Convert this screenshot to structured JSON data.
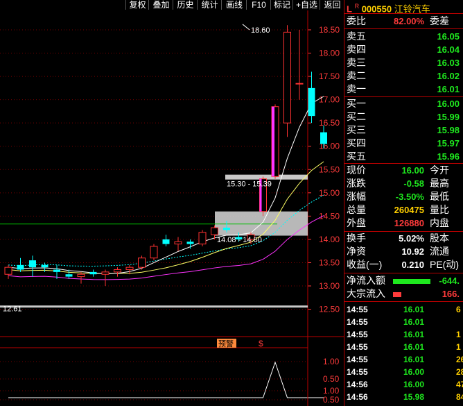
{
  "toolbar": {
    "buttons": [
      "复权",
      "叠加",
      "历史",
      "统计",
      "画线",
      "F10",
      "标记",
      "+自选",
      "返回"
    ]
  },
  "chart": {
    "price_ticks": [
      "18.50",
      "18.00",
      "17.50",
      "17.00",
      "16.50",
      "16.00",
      "15.50",
      "15.00",
      "14.50",
      "14.00",
      "13.50",
      "13.00",
      "12.50"
    ],
    "sub_ticks": [
      "1.00",
      "0.50",
      "1.00",
      "0.50"
    ],
    "high_label": "18.60",
    "low_label": "12.61",
    "zone_upper_label": "15.30 - 15.39",
    "zone_lower_label": "14.08 - 14.60",
    "signal_label": "预警",
    "dollar_label": "$",
    "colors": {
      "up": "#ff3232",
      "down": "#00ffff",
      "ma5": "#ffffff",
      "ma10": "#ffff66",
      "ma20": "#ff33ff",
      "ma60": "#00ffff",
      "hline": "#00c000"
    }
  },
  "chart_data": {
    "type": "candlestick",
    "ylim": [
      12.5,
      18.8
    ],
    "candles": [
      {
        "o": 13.25,
        "h": 13.45,
        "l": 13.15,
        "c": 13.4
      },
      {
        "o": 13.45,
        "h": 13.6,
        "l": 13.3,
        "c": 13.35
      },
      {
        "o": 13.55,
        "h": 13.65,
        "l": 13.2,
        "c": 13.4
      },
      {
        "o": 13.45,
        "h": 13.5,
        "l": 13.3,
        "c": 13.4
      },
      {
        "o": 13.35,
        "h": 13.45,
        "l": 13.15,
        "c": 13.3
      },
      {
        "o": 13.25,
        "h": 13.35,
        "l": 13.15,
        "c": 13.2
      },
      {
        "o": 13.2,
        "h": 13.3,
        "l": 13.05,
        "c": 13.25
      },
      {
        "o": 13.3,
        "h": 13.35,
        "l": 13.2,
        "c": 13.25
      },
      {
        "o": 13.25,
        "h": 13.35,
        "l": 13.0,
        "c": 13.3
      },
      {
        "o": 13.3,
        "h": 13.4,
        "l": 13.2,
        "c": 13.35
      },
      {
        "o": 13.35,
        "h": 13.45,
        "l": 13.25,
        "c": 13.4
      },
      {
        "o": 13.4,
        "h": 13.65,
        "l": 13.35,
        "c": 13.6
      },
      {
        "o": 13.6,
        "h": 13.9,
        "l": 13.55,
        "c": 13.85
      },
      {
        "o": 14.0,
        "h": 14.1,
        "l": 13.85,
        "c": 13.9
      },
      {
        "o": 13.9,
        "h": 14.05,
        "l": 13.75,
        "c": 13.95
      },
      {
        "o": 13.95,
        "h": 14.0,
        "l": 13.8,
        "c": 13.9
      },
      {
        "o": 13.9,
        "h": 14.2,
        "l": 13.85,
        "c": 14.15
      },
      {
        "o": 14.1,
        "h": 14.3,
        "l": 14.0,
        "c": 14.25
      },
      {
        "o": 14.25,
        "h": 14.4,
        "l": 14.15,
        "c": 14.2
      },
      {
        "o": 14.05,
        "h": 14.15,
        "l": 13.95,
        "c": 14.0
      },
      {
        "o": 14.0,
        "h": 14.15,
        "l": 13.9,
        "c": 14.1
      },
      {
        "o": 14.6,
        "h": 15.35,
        "l": 14.5,
        "c": 15.3
      },
      {
        "o": 15.35,
        "h": 16.9,
        "l": 15.3,
        "c": 16.85
      },
      {
        "o": 16.5,
        "h": 18.6,
        "l": 16.2,
        "c": 18.45
      },
      {
        "o": 17.35,
        "h": 18.5,
        "l": 17.0,
        "c": 17.35
      },
      {
        "o": 17.25,
        "h": 17.6,
        "l": 16.5,
        "c": 16.65
      },
      {
        "o": 16.3,
        "h": 16.45,
        "l": 15.95,
        "c": 16.05
      }
    ],
    "volume_signal": [
      0,
      0,
      0,
      0,
      0,
      0,
      0,
      0,
      0,
      0,
      0,
      0,
      0,
      0,
      0,
      0,
      0,
      0,
      0,
      0,
      0,
      0,
      1,
      0,
      0,
      0,
      0
    ]
  },
  "panel": {
    "code": "000550",
    "name": "江铃汽车",
    "l_mark": "L",
    "r_mark": "R",
    "weibi_label": "委比",
    "weibi_val": "82.00%",
    "weicha_label": "委差",
    "asks": [
      {
        "label": "卖五",
        "price": "16.05"
      },
      {
        "label": "卖四",
        "price": "16.04"
      },
      {
        "label": "卖三",
        "price": "16.03"
      },
      {
        "label": "卖二",
        "price": "16.02"
      },
      {
        "label": "卖一",
        "price": "16.01"
      }
    ],
    "bids": [
      {
        "label": "买一",
        "price": "16.00"
      },
      {
        "label": "买二",
        "price": "15.99"
      },
      {
        "label": "买三",
        "price": "15.98"
      },
      {
        "label": "买四",
        "price": "15.97"
      },
      {
        "label": "买五",
        "price": "15.96"
      }
    ],
    "quote": [
      {
        "label": "现价",
        "val": "16.00",
        "right": "今开",
        "color": "green"
      },
      {
        "label": "涨跌",
        "val": "-0.58",
        "right": "最高",
        "color": "green"
      },
      {
        "label": "涨幅",
        "val": "-3.50%",
        "right": "最低",
        "color": "green"
      },
      {
        "label": "总量",
        "val": "260475",
        "right": "量比",
        "color": "yellow"
      },
      {
        "label": "外盘",
        "val": "126880",
        "right": "内盘",
        "color": "red"
      }
    ],
    "stats": [
      {
        "label": "换手",
        "val": "5.02%",
        "right": "股本"
      },
      {
        "label": "净资",
        "val": "10.92",
        "right": "流通"
      },
      {
        "label": "收益(一)",
        "val": "0.210",
        "right": "PE(动)"
      }
    ],
    "flow": [
      {
        "label": "净流入额",
        "val": "-644.",
        "color": "green"
      },
      {
        "label": "大宗流入",
        "val": "166.",
        "color": "red"
      }
    ],
    "trades": [
      {
        "time": "14:55",
        "price": "16.01",
        "vol": "6",
        "color": "green"
      },
      {
        "time": "14:55",
        "price": "16.01",
        "vol": "",
        "color": "green"
      },
      {
        "time": "14:55",
        "price": "16.01",
        "vol": "1",
        "color": "green"
      },
      {
        "time": "14:55",
        "price": "16.01",
        "vol": "1",
        "color": "green"
      },
      {
        "time": "14:55",
        "price": "16.01",
        "vol": "26",
        "color": "green"
      },
      {
        "time": "14:55",
        "price": "16.00",
        "vol": "28",
        "color": "green"
      },
      {
        "time": "14:56",
        "price": "16.00",
        "vol": "47",
        "color": "green"
      },
      {
        "time": "14:56",
        "price": "15.98",
        "vol": "84",
        "color": "green"
      }
    ]
  }
}
